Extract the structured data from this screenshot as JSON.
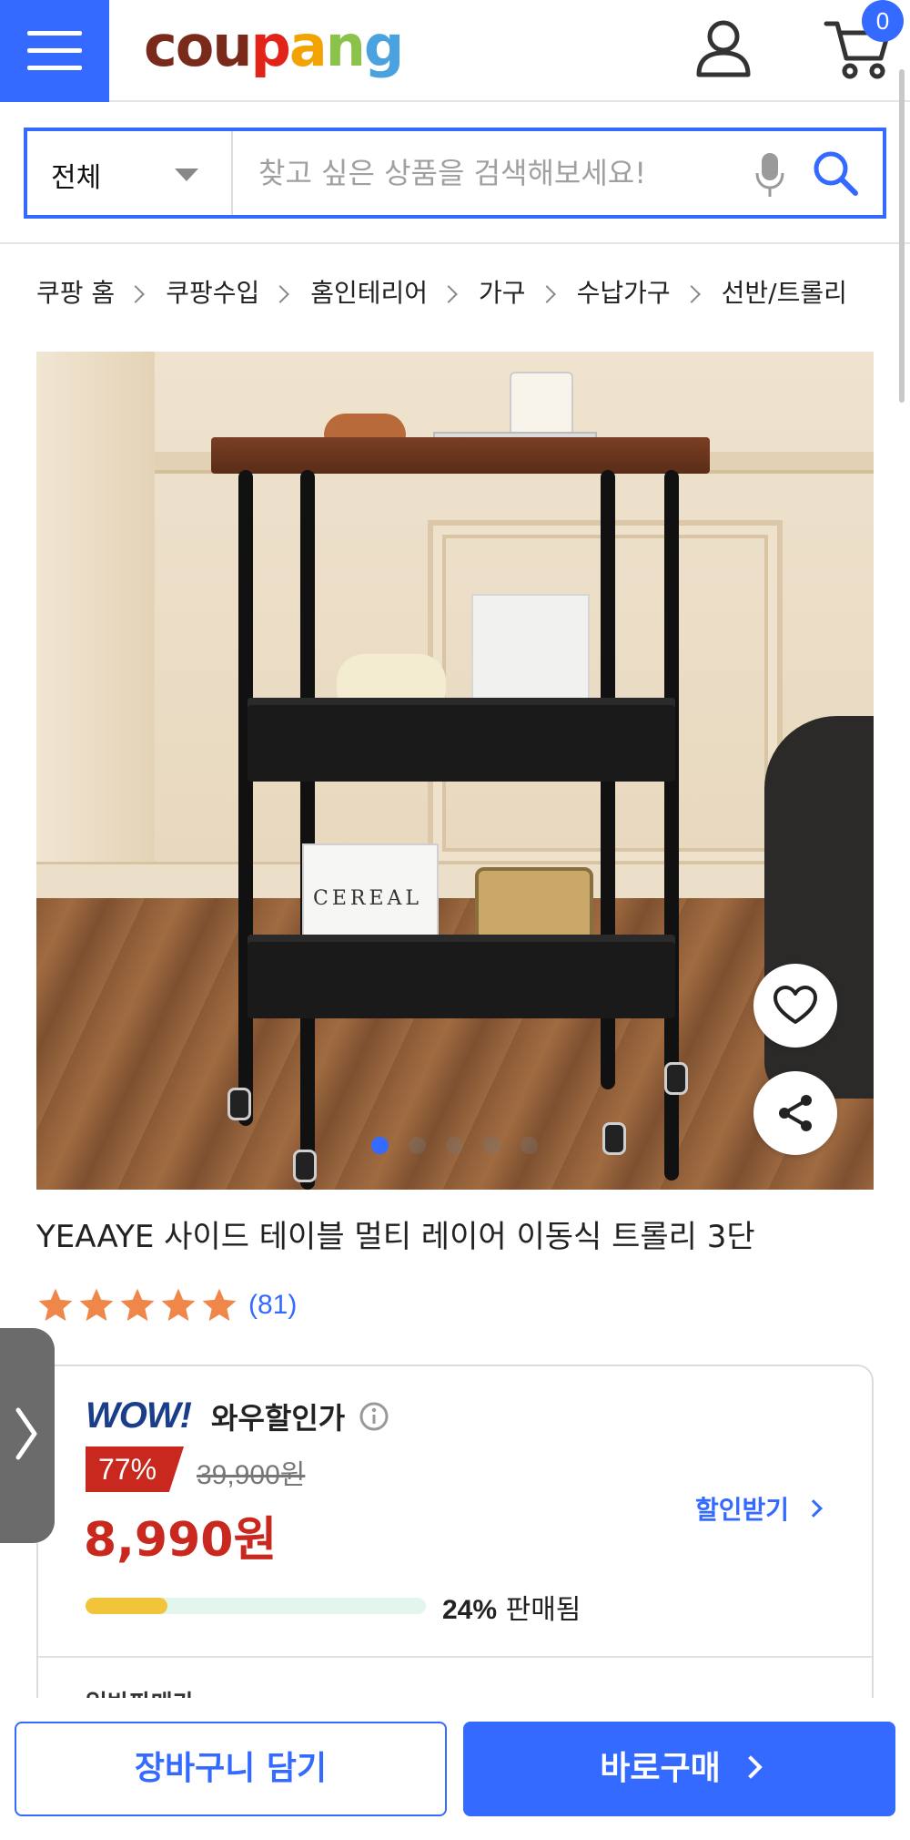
{
  "header": {
    "logo_text": "coupang",
    "logo_letters": [
      "c",
      "o",
      "u",
      "p",
      "a",
      "n",
      "g"
    ],
    "cart_count": "0",
    "brand_color": "#346aff"
  },
  "search": {
    "category": "전체",
    "placeholder": "찾고 싶은 상품을 검색해보세요!"
  },
  "breadcrumb": [
    "쿠팡 홈",
    "쿠팡수입",
    "홈인테리어",
    "가구",
    "수납가구",
    "선반/트롤리"
  ],
  "product": {
    "image_alt": "YEAAYE 사이드 테이블 멀티 레이어 이동식 트롤리 3단",
    "image_count": 5,
    "active_image": 0,
    "magazine_text": "CEREAL",
    "title": "YEAAYE 사이드 테이블 멀티 레이어 이동식 트롤리 3단",
    "rating_stars": 5,
    "review_count": "(81)"
  },
  "price": {
    "wow_logo": "WOW!",
    "wow_label": "와우할인가",
    "discount": "77%",
    "original": "39,900원",
    "sale": "8,990원",
    "coupon_link": "할인받기",
    "sold_percent": 24,
    "sold_value": "24%",
    "sold_label": "판매됨",
    "normal_price_label": "일반판매가",
    "discount_color": "#c8281e"
  },
  "actions": {
    "cart_button": "장바구니 담기",
    "buy_button": "바로구매"
  }
}
